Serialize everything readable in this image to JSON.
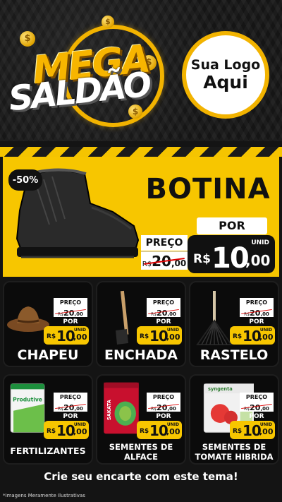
{
  "header": {
    "title_line1": "MEGA",
    "title_line2": "SALDÃO",
    "coin_symbol": "$",
    "logo_line1": "Sua Logo",
    "logo_line2": "Aqui"
  },
  "featured": {
    "discount": "-50%",
    "name": "BOTINA",
    "old_label": "PREÇO",
    "old_currency": "R$",
    "old_int": "20",
    "old_dec": ",00",
    "por_label": "POR",
    "unit_label": "UNID",
    "new_currency": "R$",
    "new_int": "10",
    "new_dec": ",00"
  },
  "products": [
    {
      "name": "CHAPEU",
      "old_label": "PREÇO",
      "old_currency": "R$",
      "old_int": "20",
      "old_dec": ",00",
      "por_label": "POR",
      "unit_label": "UNID",
      "new_currency": "R$",
      "new_int": "10",
      "new_dec": ",00",
      "icon": "hat"
    },
    {
      "name": "ENCHADA",
      "old_label": "PREÇO",
      "old_currency": "R$",
      "old_int": "20",
      "old_dec": ",00",
      "por_label": "POR",
      "unit_label": "UNID",
      "new_currency": "R$",
      "new_int": "10",
      "new_dec": ",00",
      "icon": "hoe"
    },
    {
      "name": "RASTELO",
      "old_label": "PREÇO",
      "old_currency": "R$",
      "old_int": "20",
      "old_dec": ",00",
      "por_label": "POR",
      "unit_label": "UNID",
      "new_currency": "R$",
      "new_int": "10",
      "new_dec": ",00",
      "icon": "rake"
    },
    {
      "name_line1": "FERTILIZANTES",
      "name_line2": "",
      "old_label": "PREÇO",
      "old_currency": "R$",
      "old_int": "20",
      "old_dec": ",00",
      "por_label": "POR",
      "unit_label": "UNID",
      "new_currency": "R$",
      "new_int": "10",
      "new_dec": ",00",
      "icon": "fertilizer-bag",
      "pack_text": "Produtive"
    },
    {
      "name_line1": "SEMENTES DE",
      "name_line2": "ALFACE",
      "old_label": "PREÇO",
      "old_currency": "R$",
      "old_int": "20",
      "old_dec": ",00",
      "por_label": "POR",
      "unit_label": "UNID",
      "new_currency": "R$",
      "new_int": "10",
      "new_dec": ",00",
      "icon": "seed-pack-lettuce",
      "pack_text": "SAKATA"
    },
    {
      "name_line1": "SEMENTES DE",
      "name_line2": "TOMATE HIBRIDA",
      "old_label": "PREÇO",
      "old_currency": "R$",
      "old_int": "20",
      "old_dec": ",00",
      "por_label": "POR",
      "unit_label": "UNID",
      "new_currency": "R$",
      "new_int": "10",
      "new_dec": ",00",
      "icon": "seed-pack-tomato",
      "pack_text": "syngenta"
    }
  ],
  "footer": {
    "cta": "Crie seu encarte com este tema!",
    "disclaimer": "*Imagens Meramente Ilustrativas"
  },
  "colors": {
    "accent_yellow": "#f7c600",
    "dark": "#111111",
    "strike_red": "#dd0000"
  }
}
